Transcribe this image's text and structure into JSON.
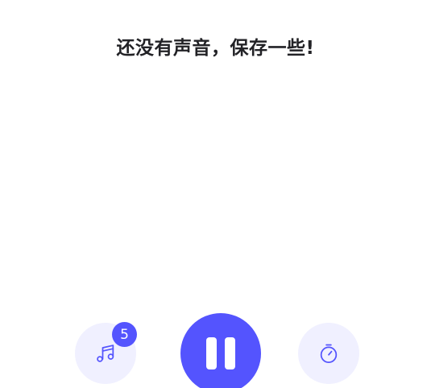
{
  "empty_state": {
    "title": "还没有声音，保存一些!"
  },
  "controls": {
    "sounds_icon": "music-notes-icon",
    "sounds_count": "5",
    "play_state": "paused",
    "play_icon": "pause-icon",
    "timer_icon": "stopwatch-icon"
  },
  "colors": {
    "accent": "#5454fe",
    "secondary_bg": "#f0f0ff",
    "title_text": "#222226",
    "background": "#ffffff"
  }
}
